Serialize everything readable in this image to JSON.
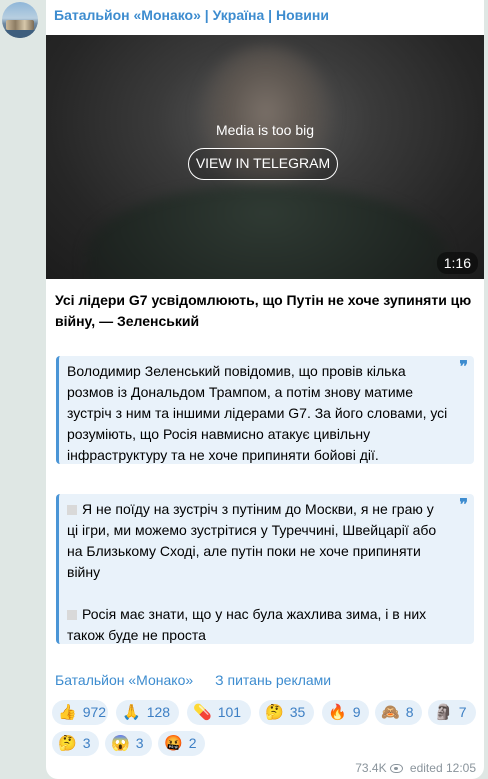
{
  "channel": {
    "title": "Батальйон «Монако» | Україна | Новини"
  },
  "media": {
    "message": "Media is too big",
    "button_label": "VIEW IN TELEGRAM",
    "duration": "1:16"
  },
  "post": {
    "headline": "Усі лідери G7 усвідомлюють, що Путін не хоче зупиняти цю війну, — Зеленський",
    "quote1": "Володимир Зеленський повідомив, що провів кілька розмов із Дональдом Трампом, а потім знову матиме зустріч з ним та іншими лідерами G7. За його словами, усі розуміють, що Росія навмисно атакує цивільну інфраструктуру та не хоче припиняти бойові дії.",
    "quote2_p1": "Я не поїду на зустріч з путіним до Москви, я не граю у ці ігри, ми можемо зустрітися у Туреччині, Швейцарії або на Близькому Сході, але путін поки не хоче припиняти війну",
    "quote2_p2": "Росія має знати, що у нас була жахлива зима, і в них також буде не проста",
    "quote_mark": "❞"
  },
  "links": {
    "channel": "Батальйон «Монако»",
    "ads": "З питань реклами"
  },
  "reactions": [
    {
      "emoji": "👍",
      "count": "972"
    },
    {
      "emoji": "🙏",
      "count": "128"
    },
    {
      "emoji": "💊",
      "count": "101"
    },
    {
      "emoji": "🤔",
      "count": "35"
    },
    {
      "emoji": "🔥",
      "count": "9"
    },
    {
      "emoji": "🙈",
      "count": "8"
    },
    {
      "emoji": "🗿",
      "count": "7"
    },
    {
      "emoji": "🤔",
      "count": "3"
    },
    {
      "emoji": "😱",
      "count": "3"
    },
    {
      "emoji": "🤬",
      "count": "2"
    }
  ],
  "meta": {
    "views": "73.4K",
    "edited_label": "edited",
    "time": "12:05"
  },
  "icons": {
    "views": "eye-icon"
  }
}
